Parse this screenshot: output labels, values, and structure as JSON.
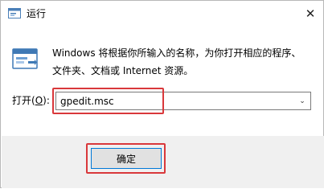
{
  "window": {
    "title": "运行",
    "close_glyph": "✕",
    "app_icon": "run-dialog-icon"
  },
  "main": {
    "icon": "run-icon",
    "description_line1": "Windows 将根据你所输入的名称，为你打开相应的程序、",
    "description_line2": "文件夹、文档或 Internet 资源。"
  },
  "open_field": {
    "label_prefix": "打开(",
    "label_accel": "O",
    "label_suffix": "):",
    "value": "gpedit.msc",
    "dropdown_glyph": "⌄"
  },
  "buttons": {
    "ok_label": "确定"
  },
  "colors": {
    "highlight": "#d9383b",
    "button_focus": "#0078d7",
    "footer_bg": "#f0f0f0"
  }
}
